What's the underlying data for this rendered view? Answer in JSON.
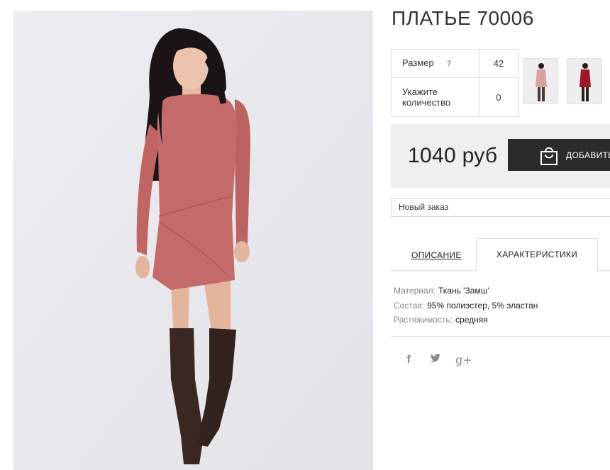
{
  "product": {
    "title": "ПЛАТЬЕ 70006",
    "size_label": "Размер",
    "size_help": "?",
    "size_value": "42",
    "qty_label_line1": "Укажите",
    "qty_label_line2": "количество",
    "qty_value": "0",
    "thumbnails": [
      {
        "name": "thumb-pink-dress",
        "color": "#dba0a0"
      },
      {
        "name": "thumb-red-dress",
        "color": "#9b1826"
      }
    ],
    "price": "1040 руб",
    "add_to_cart_label": "ДОБАВИТЬ"
  },
  "order": {
    "selected": "Новый заказ"
  },
  "tabs": {
    "description": "ОПИСАНИЕ",
    "characteristics": "ХАРАКТЕРИСТИКИ"
  },
  "specs": [
    {
      "key": "Материал:",
      "value": "Ткань 'Замш'"
    },
    {
      "key": "Состав:",
      "value": "95% полиэстер, 5% эластан"
    },
    {
      "key": "Растяжимость:",
      "value": "средняя"
    }
  ],
  "social": {
    "facebook_glyph": "f",
    "googleplus_glyph": "g+"
  },
  "icons": [
    "question-icon",
    "shopping-bag-icon",
    "facebook-icon",
    "twitter-icon",
    "google-plus-icon"
  ],
  "colors": {
    "dress": "#c56a6a",
    "button_bg": "#2b2b2b",
    "price_box_bg": "#efefef",
    "photo_bg": "#e9e9ee"
  }
}
